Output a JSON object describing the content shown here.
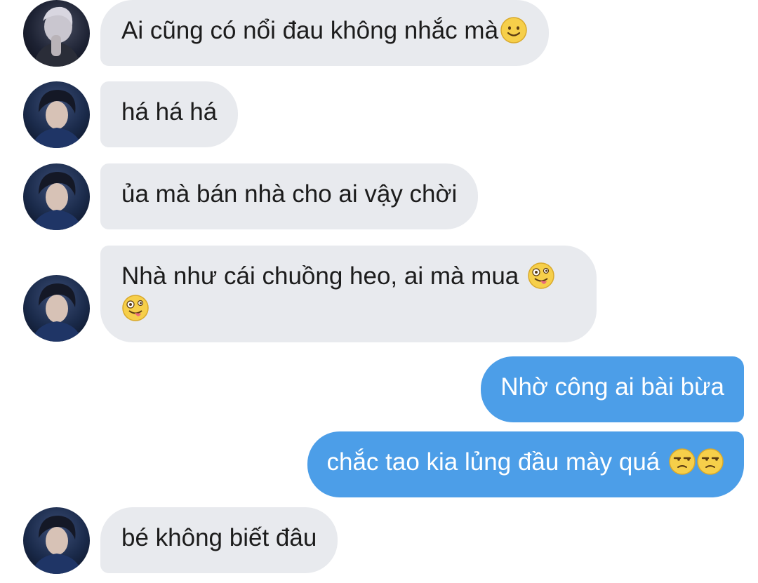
{
  "messages": [
    {
      "text": "Ai cũng có nổi đau không nhắc mà",
      "emoji": "smiling-face-icon"
    },
    {
      "text": "há há há"
    },
    {
      "text": "ủa mà bán nhà cho ai vậy chời"
    },
    {
      "line1": "Nhà như cái chuồng heo, ai mà mua",
      "emoji": "zany-face-icon"
    },
    {
      "text": "Nhờ công ai bài bừa"
    },
    {
      "text": "chắc tao kia lủng đầu mày quá",
      "emoji": "unamused-face-icon"
    },
    {
      "text": "bé không biết đâu"
    }
  ],
  "colors": {
    "incoming_bubble": "#e8eaee",
    "outgoing_bubble": "#4c9ee8",
    "incoming_text": "#1c1c1c",
    "outgoing_text": "#ffffff"
  }
}
